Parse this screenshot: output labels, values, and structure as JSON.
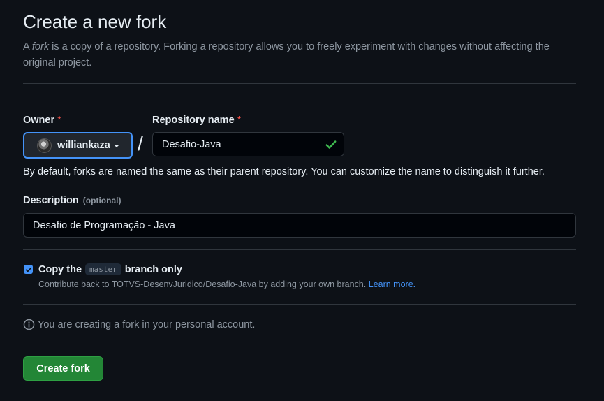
{
  "header": {
    "title": "Create a new fork",
    "subtitle_prefix": "A ",
    "subtitle_em": "fork",
    "subtitle_rest": " is a copy of a repository. Forking a repository allows you to freely experiment with changes without affecting the original project."
  },
  "form": {
    "owner": {
      "label": "Owner",
      "required_mark": "*",
      "selected": "williankaza"
    },
    "separator": "/",
    "repo_name": {
      "label": "Repository name",
      "required_mark": "*",
      "value": "Desafio-Java",
      "status_icon": "check-icon"
    },
    "name_hint": "By default, forks are named the same as their parent repository. You can customize the name to distinguish it further.",
    "description": {
      "label": "Description",
      "optional": "(optional)",
      "value": "Desafio de Programação - Java"
    },
    "copy_branch": {
      "checked": true,
      "label_prefix": "Copy the",
      "branch": "master",
      "label_suffix": "branch only",
      "help_text": "Contribute back to TOTVS-DesenvJuridico/Desafio-Java by adding your own branch.",
      "link_text": "Learn more."
    },
    "info": {
      "icon": "info-icon",
      "text": "You are creating a fork in your personal account."
    },
    "submit_label": "Create fork"
  },
  "colors": {
    "background": "#0d1117",
    "primary_button": "#238636",
    "accent": "#4493f8",
    "required": "#f85149",
    "success": "#3fb950"
  }
}
